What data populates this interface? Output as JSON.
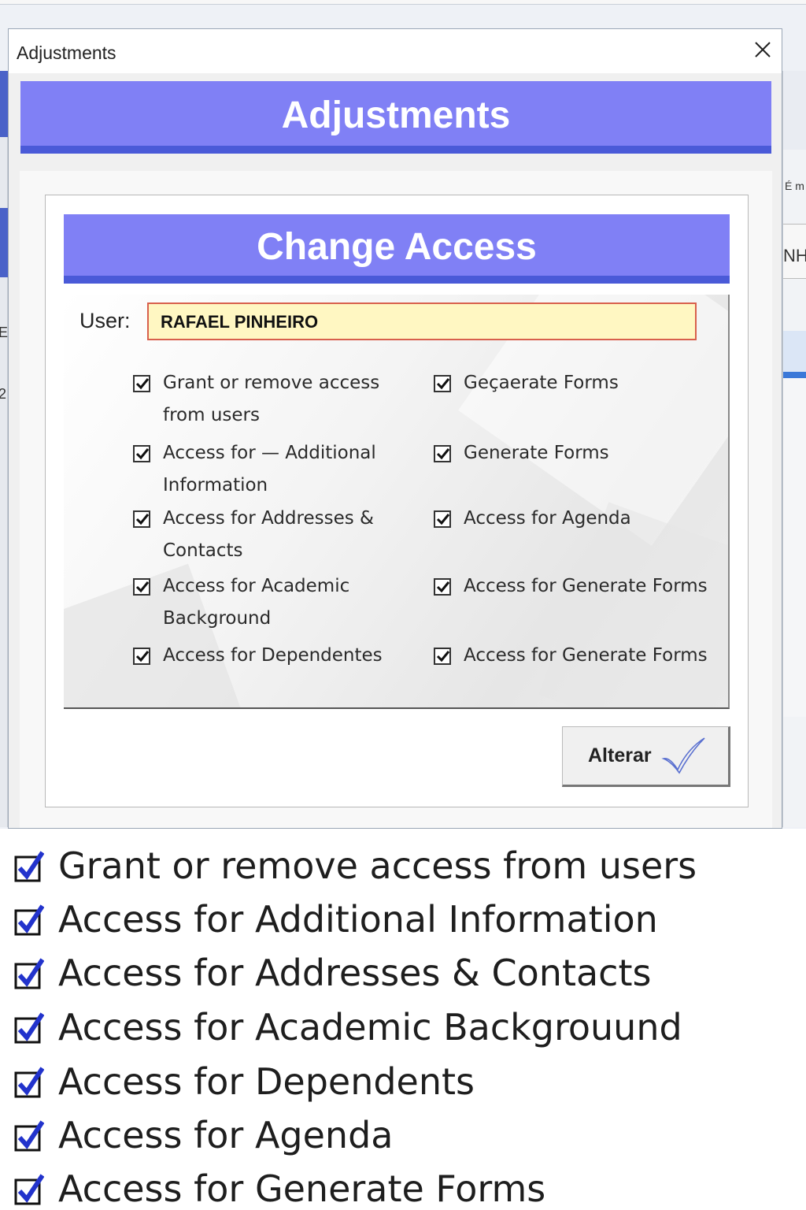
{
  "window": {
    "title": "Adjustments",
    "close_icon": "close-icon"
  },
  "background_fragments": {
    "right_text_1": "É m",
    "right_text_2": "NH",
    "left_text_1": "E",
    "left_text_2": "2"
  },
  "header": {
    "banner_title": "Adjustments"
  },
  "change_access": {
    "banner_title": "Change Access",
    "user_label": "User:",
    "user_value": "RAFAEL PINHEIRO",
    "permissions_left": [
      {
        "line1": "Grant or remove access",
        "line2": "from users",
        "checked": true
      },
      {
        "line1": "Access for — Additional",
        "line2": "Information",
        "checked": true
      },
      {
        "line1": "Access for Addresses &",
        "line2": "Contacts",
        "checked": true
      },
      {
        "line1": "Access for Academic",
        "line2": "Background",
        "checked": true
      },
      {
        "line1": "Access for Dependentes",
        "line2": "",
        "checked": true
      }
    ],
    "permissions_right": [
      {
        "line1": "Geçaerate Forms",
        "checked": true
      },
      {
        "line1": "Generate Forms",
        "checked": true
      },
      {
        "line1": "Access for Agenda",
        "checked": true
      },
      {
        "line1": "Access for Generate Forms",
        "checked": true
      },
      {
        "line1": "Access for Generate Forms",
        "checked": true
      }
    ],
    "submit_label": "Alterar",
    "submit_icon": "checkmark-icon"
  },
  "summary_list": [
    "Grant or remove access  from users",
    "Access for Additional Information",
    "Access for Addresses & Contacts",
    "Access for Academic Backgrouund",
    "Access for Dependents",
    "Access for Agenda",
    "Access for Generate Forms"
  ],
  "colors": {
    "banner": "#8080f5",
    "banner_underline": "#4a5ad8",
    "user_field_bg": "#fff7c2",
    "user_field_border": "#d8604c",
    "summary_check": "#2233cc"
  }
}
